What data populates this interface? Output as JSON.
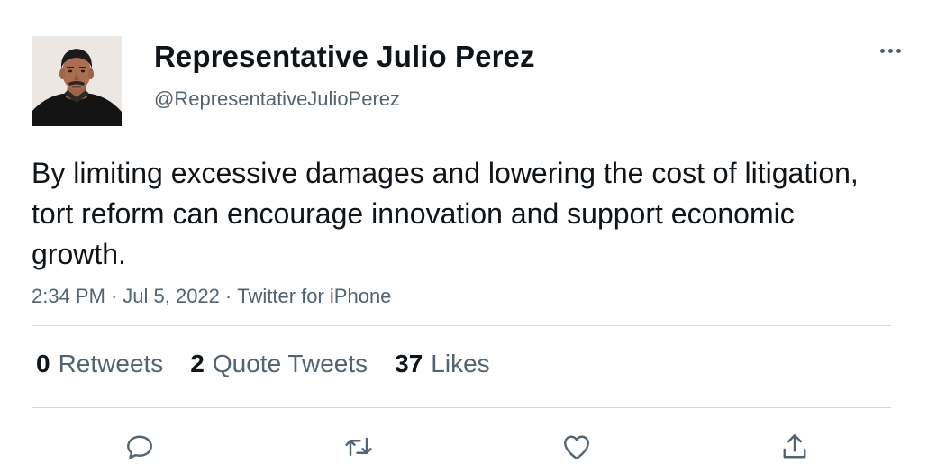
{
  "author": {
    "display_name": "Representative Julio Perez",
    "handle": "@RepresentativeJulioPerez"
  },
  "tweet": {
    "text": "By limiting excessive damages and lowering the cost of litigation, tort reform can encourage innovation and support economic growth.",
    "time": "2:34 PM",
    "date": "Jul 5, 2022",
    "source": "Twitter for iPhone",
    "separator": "·"
  },
  "stats": {
    "retweets": {
      "count": "0",
      "label": "Retweets"
    },
    "quote_tweets": {
      "count": "2",
      "label": "Quote Tweets"
    },
    "likes": {
      "count": "37",
      "label": "Likes"
    }
  },
  "actions": {
    "icons": [
      "reply-icon",
      "retweet-icon",
      "like-icon",
      "share-icon"
    ]
  },
  "colors": {
    "text_primary": "#0f1419",
    "text_secondary": "#536471",
    "divider": "#cfd9de",
    "background": "#ffffff"
  }
}
